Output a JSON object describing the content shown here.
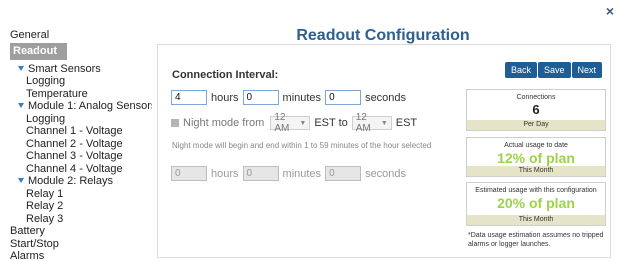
{
  "sidebar": {
    "items": [
      {
        "label": "General",
        "kind": "top"
      },
      {
        "label": "Readout",
        "kind": "selected"
      },
      {
        "label": "Smart Sensors",
        "kind": "group"
      },
      {
        "label": "Logging",
        "kind": "child"
      },
      {
        "label": "Temperature",
        "kind": "child"
      },
      {
        "label": "Module 1: Analog Sensors",
        "kind": "group"
      },
      {
        "label": "Logging",
        "kind": "child"
      },
      {
        "label": "Channel 1 - Voltage",
        "kind": "child"
      },
      {
        "label": "Channel 2 - Voltage",
        "kind": "child"
      },
      {
        "label": "Channel 3 - Voltage",
        "kind": "child"
      },
      {
        "label": "Channel 4 - Voltage",
        "kind": "child"
      },
      {
        "label": "Module 2: Relays",
        "kind": "group"
      },
      {
        "label": "Relay 1",
        "kind": "child"
      },
      {
        "label": "Relay 2",
        "kind": "child"
      },
      {
        "label": "Relay 3",
        "kind": "child"
      },
      {
        "label": "Battery",
        "kind": "top"
      },
      {
        "label": "Start/Stop",
        "kind": "top"
      },
      {
        "label": "Alarms",
        "kind": "top"
      }
    ]
  },
  "close_icon": "×",
  "title": "Readout Configuration",
  "connection": {
    "label": "Connection Interval:",
    "hours_value": "4",
    "hours_label": "hours",
    "minutes_value": "0",
    "minutes_label": "minutes",
    "seconds_value": "0",
    "seconds_label": "seconds"
  },
  "night_mode": {
    "label": "Night mode from",
    "from_value": "12 AM",
    "from_tz": "EST to",
    "to_value": "12 AM",
    "to_tz": "EST",
    "note": "Night mode will begin and end within 1 to 59 minutes of the hour selected",
    "hours_value": "0",
    "hours_label": "hours",
    "minutes_value": "0",
    "minutes_label": "minutes",
    "seconds_value": "0",
    "seconds_label": "seconds"
  },
  "buttons": {
    "back": "Back",
    "save": "Save",
    "next": "Next"
  },
  "stats": {
    "connections": {
      "caption": "Connections",
      "value": "6",
      "footer": "Per Day"
    },
    "actual": {
      "caption": "Actual usage to date",
      "value": "12% of plan",
      "footer": "This Month"
    },
    "estimated": {
      "caption": "Estimated usage with this configuration",
      "value": "20% of plan",
      "footer": "This Month"
    }
  },
  "footnote": "*Data usage estimation assumes no tripped alarms or logger launches."
}
